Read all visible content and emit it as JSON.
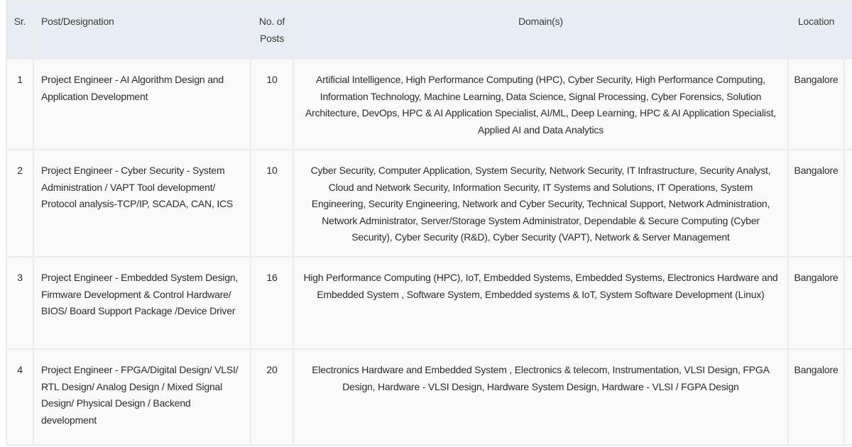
{
  "table": {
    "headers": {
      "sr": "Sr.",
      "post": "Post/Designation",
      "posts_count": "No. of Posts",
      "domains": "Domain(s)",
      "location": "Location"
    },
    "rows": [
      {
        "sr": "1",
        "post": "Project Engineer - AI Algorithm Design and Application Development",
        "posts_count": "10",
        "domains": "Artificial Intelligence, High Performance Computing (HPC), Cyber Security, High Performance Computing, Information Technology, Machine Learning, Data Science, Signal Processing, Cyber Forensics, Solution Architecture, DevOps, HPC & AI Application Specialist, AI/ML, Deep Learning, HPC & AI Application Specialist, Applied AI and Data Analytics",
        "location": "Bangalore"
      },
      {
        "sr": "2",
        "post": "Project Engineer - Cyber Security - System Administration / VAPT Tool development/ Protocol analysis-TCP/IP, SCADA, CAN, ICS",
        "posts_count": "10",
        "domains": "Cyber Security, Computer Application, System Security, Network Security, IT Infrastructure, Security Analyst, Cloud and Network Security, Information Security, IT Systems and Solutions, IT Operations, System Engineering, Security Engineering, Network and Cyber Security, Technical Support, Network Administration, Network Administrator, Server/Storage System Administrator, Dependable & Secure Computing (Cyber Security), Cyber Security (R&D), Cyber Security (VAPT), Network & Server Management",
        "location": "Bangalore"
      },
      {
        "sr": "3",
        "post": "Project Engineer - Embedded System Design, Firmware Development & Control Hardware/ BIOS/ Board Support Package /Device Driver",
        "posts_count": "16",
        "domains": "High Performance Computing (HPC), IoT, Embedded Systems, Embedded Systems, Electronics Hardware and Embedded System , Software System, Embedded systems & IoT, System Software Development (Linux)",
        "location": "Bangalore"
      },
      {
        "sr": "4",
        "post": "Project Engineer - FPGA/Digital Design/ VLSI/ RTL Design/ Analog Design / Mixed Signal Design/ Physical Design / Backend development",
        "posts_count": "20",
        "domains": "Electronics Hardware and Embedded System , Electronics & telecom, Instrumentation, VLSI Design, FPGA Design, Hardware - VLSI Design, Hardware System Design, Hardware - VLSI / FGPA Design",
        "location": "Bangalore"
      }
    ]
  },
  "colors": {
    "header_bg": "#e8edf3",
    "cell_bg": "#fafafa",
    "border": "#ececec",
    "text": "#2b2b2b"
  }
}
